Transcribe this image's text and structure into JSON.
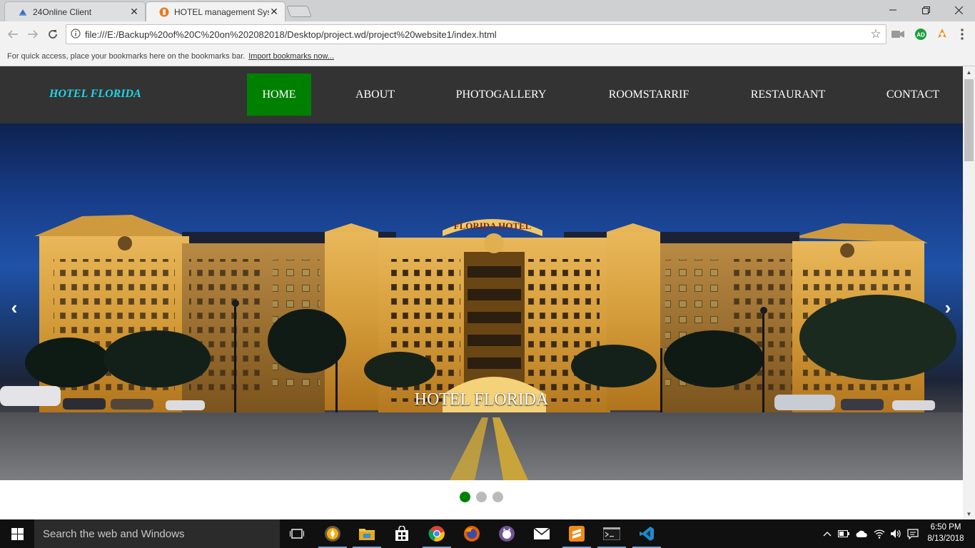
{
  "browser": {
    "tabs": [
      {
        "title": "24Online Client",
        "active": false
      },
      {
        "title": "HOTEL management Syst",
        "active": true
      }
    ],
    "url": "file:///E:/Backup%20of%20C%20on%202082018/Desktop/project.wd/project%20website1/index.html",
    "bookmarks_bar": {
      "message": "For quick access, place your bookmarks here on the bookmarks bar.",
      "link": "Import bookmarks now..."
    },
    "extension_badge": "AD"
  },
  "site": {
    "brand": "HOTEL FLORIDA",
    "menu": [
      "HOME",
      "ABOUT",
      "PHOTOGALLERY",
      "ROOMSTARRIF",
      "RESTAURANT",
      "CONTACT"
    ],
    "active_menu": "HOME",
    "carousel": {
      "caption": "HOTEL FLORIDA",
      "sign_text": "FLORIDA HOTEL",
      "prev": "‹",
      "next": "›",
      "slide_count": 3,
      "active_slide": 1
    }
  },
  "colors": {
    "navbar_bg": "#333333",
    "brand": "#21d4e6",
    "active_green": "#008000"
  },
  "taskbar": {
    "search_placeholder": "Search the web and Windows",
    "time": "6:50 PM",
    "date": "8/13/2018"
  }
}
